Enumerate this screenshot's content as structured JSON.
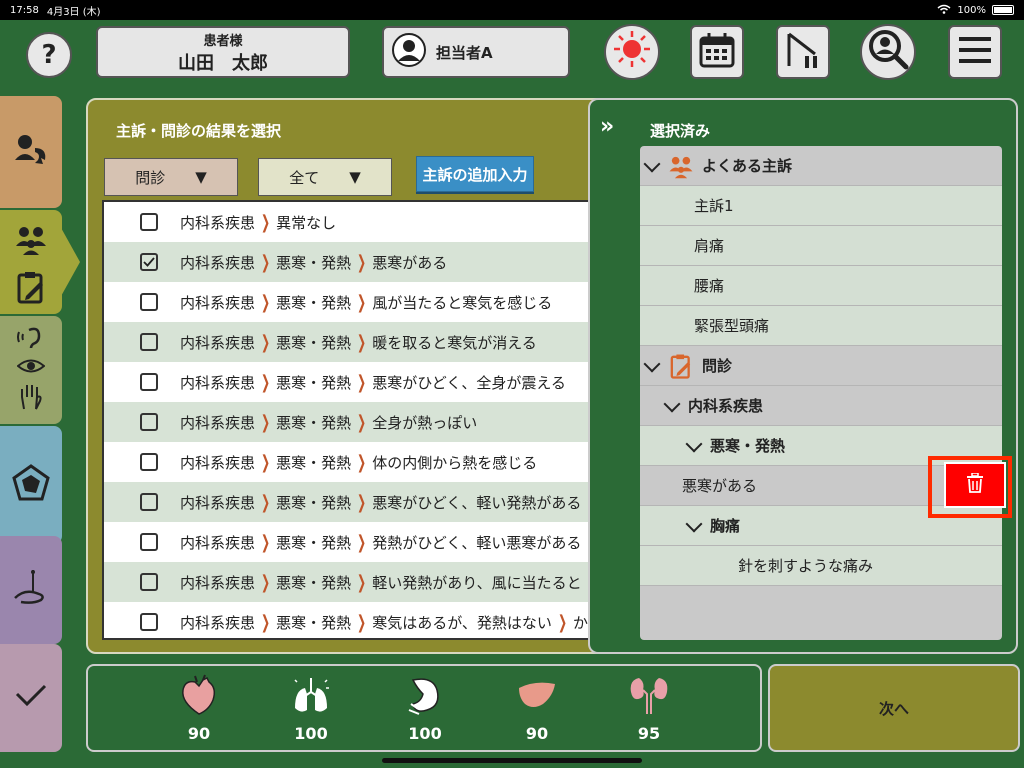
{
  "status_bar": {
    "time": "17:58",
    "date": "4月3日 (木)",
    "battery": "100%"
  },
  "header": {
    "help_label": "?",
    "patient_title": "患者様",
    "patient_name": "山田　太郎",
    "staff_name": "担当者A",
    "icons": [
      "sun-alert-icon",
      "calendar-icon",
      "play-pause-icon",
      "search-person-icon",
      "menu-icon"
    ]
  },
  "rail": {
    "colors": [
      "#c89a68",
      "#a2a53a",
      "#97a46a",
      "#7aaec0",
      "#9a86ad",
      "#b79aae"
    ],
    "icons": [
      "patient-transfer-icon",
      "group-icon",
      "clipboard-edit-icon",
      "hear-icon",
      "eye-icon",
      "hand-icon",
      "pentagon-chart-icon",
      "acupuncture-icon",
      "check-icon"
    ]
  },
  "main": {
    "title": "主訴・問診の結果を選択",
    "filter1": "問診",
    "filter2": "全て",
    "dropdown_arrow": "▼",
    "add_button": "主訴の追加入力",
    "rows": [
      {
        "checked": false,
        "parts": [
          "内科系疾患",
          "異常なし"
        ]
      },
      {
        "checked": true,
        "parts": [
          "内科系疾患",
          "悪寒・発熱",
          "悪寒がある"
        ]
      },
      {
        "checked": false,
        "parts": [
          "内科系疾患",
          "悪寒・発熱",
          "風が当たると寒気を感じる"
        ]
      },
      {
        "checked": false,
        "parts": [
          "内科系疾患",
          "悪寒・発熱",
          "暖を取ると寒気が消える"
        ]
      },
      {
        "checked": false,
        "parts": [
          "内科系疾患",
          "悪寒・発熱",
          "悪寒がひどく、全身が震える"
        ]
      },
      {
        "checked": false,
        "parts": [
          "内科系疾患",
          "悪寒・発熱",
          "全身が熱っぽい"
        ]
      },
      {
        "checked": false,
        "parts": [
          "内科系疾患",
          "悪寒・発熱",
          "体の内側から熱を感じる"
        ]
      },
      {
        "checked": false,
        "parts": [
          "内科系疾患",
          "悪寒・発熱",
          "悪寒がひどく、軽い発熱がある"
        ]
      },
      {
        "checked": false,
        "parts": [
          "内科系疾患",
          "悪寒・発熱",
          "発熱がひどく、軽い悪寒がある"
        ]
      },
      {
        "checked": false,
        "parts": [
          "内科系疾患",
          "悪寒・発熱",
          "軽い発熱があり、風に当たると"
        ]
      },
      {
        "checked": false,
        "parts": [
          "内科系疾患",
          "悪寒・発熱",
          "寒気はあるが、発熱はない",
          "か"
        ]
      }
    ]
  },
  "selected": {
    "collapse": "»",
    "title": "選択済み",
    "items": [
      {
        "kind": "header",
        "text": "よくある主訴",
        "icon": "group-icon",
        "level": 0
      },
      {
        "kind": "item",
        "text": "主訴1",
        "level": 1
      },
      {
        "kind": "item",
        "text": "肩痛",
        "level": 1
      },
      {
        "kind": "item",
        "text": "腰痛",
        "level": 1
      },
      {
        "kind": "item",
        "text": "緊張型頭痛",
        "level": 1
      },
      {
        "kind": "header",
        "text": "問診",
        "icon": "clipboard-edit-icon",
        "level": 0
      },
      {
        "kind": "group",
        "text": "内科系疾患",
        "level": 1
      },
      {
        "kind": "group",
        "text": "悪寒・発熱",
        "level": 2
      },
      {
        "kind": "leaf",
        "text": "悪寒がある",
        "level": 0
      },
      {
        "kind": "group",
        "text": "胸痛",
        "level": 2
      },
      {
        "kind": "leaf",
        "text": "針を刺すような痛み",
        "level": 3
      }
    ]
  },
  "vitals": [
    {
      "icon": "heart-icon",
      "value": "90"
    },
    {
      "icon": "lungs-icon",
      "value": "100"
    },
    {
      "icon": "stomach-icon",
      "value": "100"
    },
    {
      "icon": "liver-icon",
      "value": "90"
    },
    {
      "icon": "kidneys-icon",
      "value": "95"
    }
  ],
  "next_label": "次へ"
}
